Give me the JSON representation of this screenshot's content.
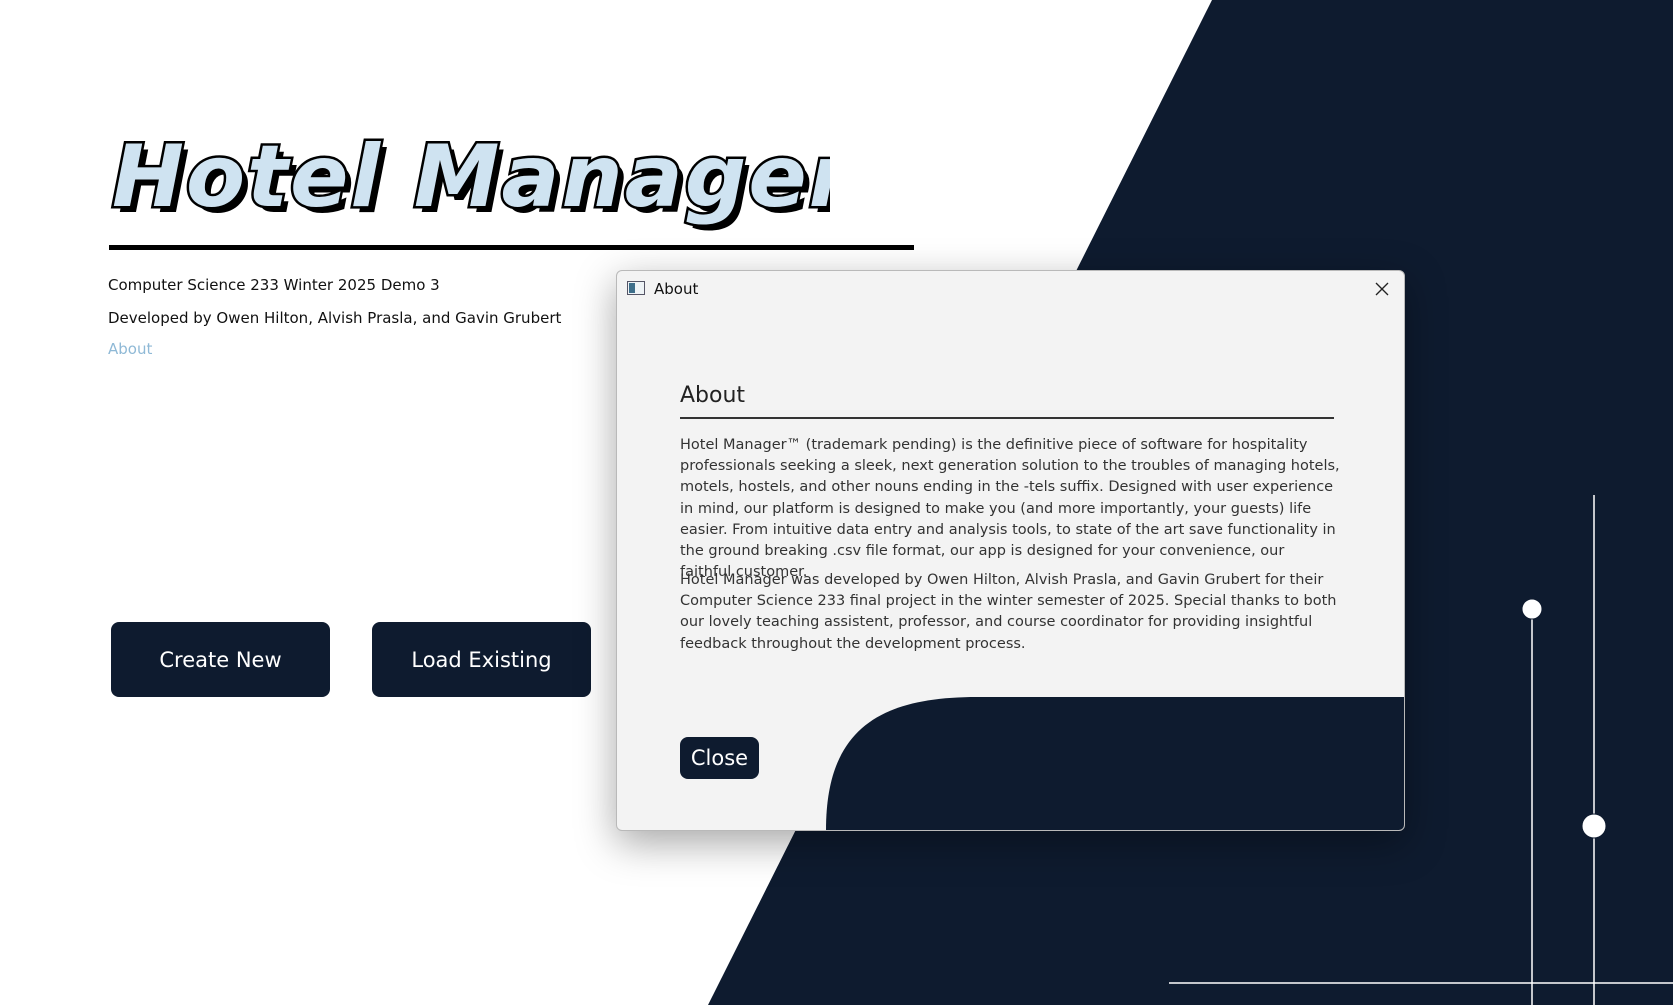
{
  "main": {
    "logo_text": "Hotel Manager",
    "course_line": "Computer Science 233 Winter 2025 Demo 3",
    "developers_line": "Developed by Owen Hilton, Alvish Prasla, and Gavin Grubert",
    "about_link": "About",
    "create_button": "Create New",
    "load_button": "Load Existing"
  },
  "dialog": {
    "window_title": "About",
    "heading": "About",
    "paragraph1": "Hotel Manager™ (trademark pending) is the definitive piece of software for hospitality professionals seeking a sleek, next generation solution to the troubles of managing hotels, motels, hostels, and other nouns ending in the -tels suffix. Designed with user experience in mind, our platform is designed to make you (and more importantly, your guests) life easier. From intuitive data entry and analysis tools, to state of the art save functionality in the ground breaking .csv file format, our app is designed for your convenience, our faithful customer.",
    "paragraph2": "Hotel Manager was developed by Owen Hilton, Alvish Prasla, and Gavin Grubert for their Computer Science 233 final project in the winter semester of 2025. Special thanks to both our lovely teaching assistent, professor, and course coordinator for providing insightful feedback throughout the development process.",
    "close_button": "Close"
  },
  "colors": {
    "navy": "#0e1b2f",
    "logo_fill": "#cfe3f1",
    "link": "#8fb9d6",
    "dialog_bg": "#f3f3f3"
  },
  "icons": {
    "window_icon": "app-window-icon",
    "close_icon": "close-x-icon"
  }
}
